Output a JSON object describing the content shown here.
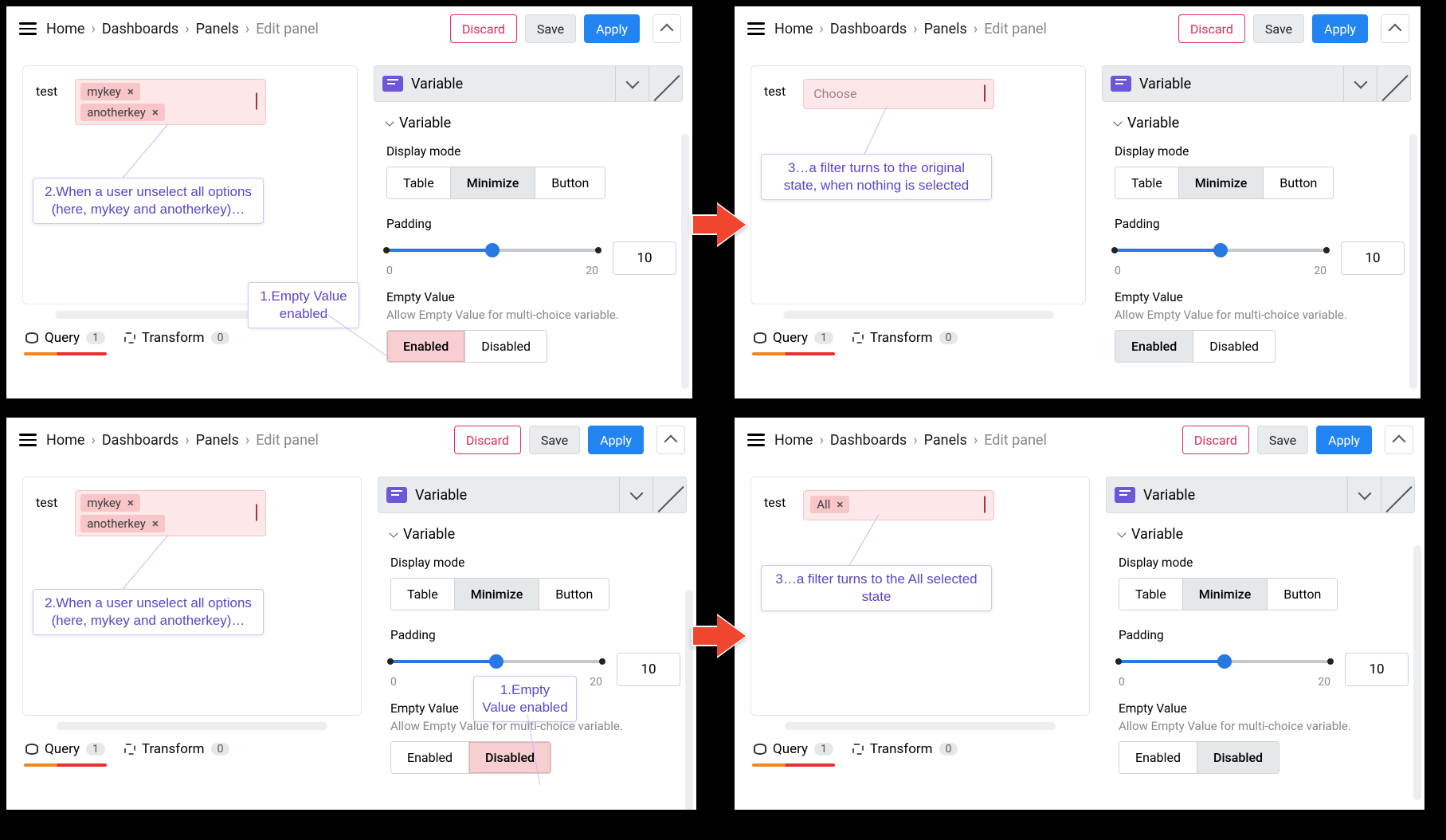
{
  "topbar": {
    "crumbs": [
      "Home",
      "Dashboards",
      "Panels"
    ],
    "current": "Edit panel",
    "discard": "Discard",
    "save": "Save",
    "apply": "Apply"
  },
  "filter": {
    "label": "test",
    "chips": [
      "mykey",
      "anotherkey"
    ],
    "choose_placeholder": "Choose",
    "all_label": "All"
  },
  "callouts": {
    "c1_empty_enabled": "1.Empty Value enabled",
    "c1_empty_enabled_b": "1.Empty Value enabled",
    "c2_unselect": "2.When a user unselect all options (here, mykey and anotherkey)…",
    "c3_original": "3…a filter turns to the original state, when nothing is selected",
    "c3_all": "3…a filter turns to the All selected state"
  },
  "tabs": {
    "query": "Query",
    "query_count": "1",
    "transform": "Transform",
    "transform_count": "0"
  },
  "panel": {
    "header": "Variable",
    "section": "Variable",
    "display_mode_label": "Display mode",
    "display_mode": {
      "table": "Table",
      "minimize": "Minimize",
      "button": "Button"
    },
    "padding_label": "Padding",
    "padding_min": "0",
    "padding_max": "20",
    "padding_value": "10",
    "empty_value_label": "Empty Value",
    "empty_value_desc": "Allow Empty Value for multi-choice variable.",
    "enabled": "Enabled",
    "disabled": "Disabled"
  }
}
